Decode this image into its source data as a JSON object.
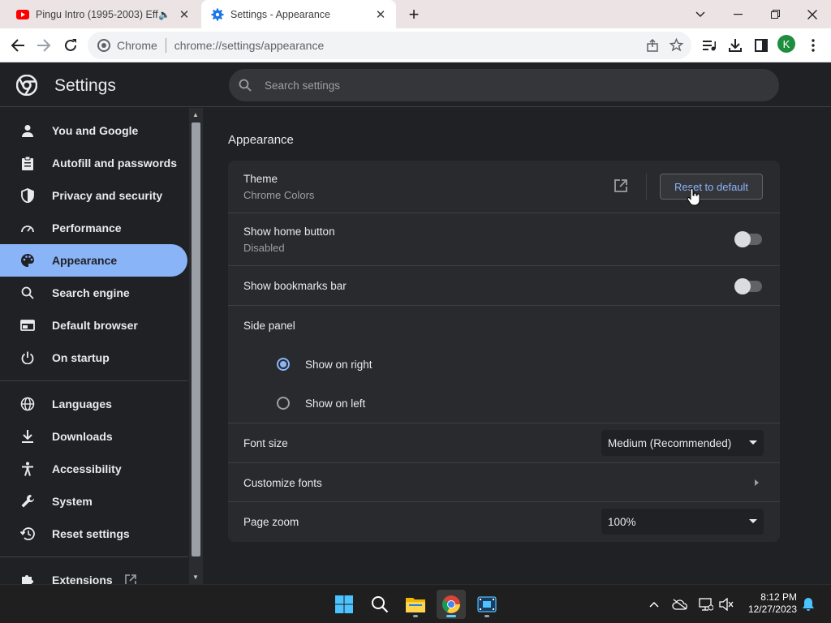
{
  "tabs": [
    {
      "title": "Pingu Intro (1995-2003) Effe",
      "audio": "🔈"
    },
    {
      "title": "Settings - Appearance"
    }
  ],
  "omnibox": {
    "site": "Chrome",
    "url": "chrome://settings/appearance"
  },
  "profile_initial": "K",
  "header": {
    "title": "Settings",
    "search_placeholder": "Search settings"
  },
  "sidebar": {
    "items": [
      {
        "label": "You and Google",
        "icon": "person-icon"
      },
      {
        "label": "Autofill and passwords",
        "icon": "clipboard-icon"
      },
      {
        "label": "Privacy and security",
        "icon": "shield-icon"
      },
      {
        "label": "Performance",
        "icon": "speedometer-icon"
      },
      {
        "label": "Appearance",
        "icon": "palette-icon"
      },
      {
        "label": "Search engine",
        "icon": "search-icon"
      },
      {
        "label": "Default browser",
        "icon": "browser-icon"
      },
      {
        "label": "On startup",
        "icon": "power-icon"
      },
      {
        "label": "Languages",
        "icon": "globe-icon"
      },
      {
        "label": "Downloads",
        "icon": "download-icon"
      },
      {
        "label": "Accessibility",
        "icon": "accessibility-icon"
      },
      {
        "label": "System",
        "icon": "wrench-icon"
      },
      {
        "label": "Reset settings",
        "icon": "history-icon"
      },
      {
        "label": "Extensions",
        "icon": "puzzle-icon"
      }
    ]
  },
  "appearance": {
    "section_title": "Appearance",
    "theme": {
      "label": "Theme",
      "value": "Chrome Colors",
      "reset_label": "Reset to default"
    },
    "home_button": {
      "label": "Show home button",
      "value": "Disabled"
    },
    "bookmarks_bar": {
      "label": "Show bookmarks bar"
    },
    "side_panel": {
      "label": "Side panel",
      "options": [
        "Show on right",
        "Show on left"
      ],
      "selected": "Show on right"
    },
    "font_size": {
      "label": "Font size",
      "value": "Medium (Recommended)"
    },
    "customize_fonts": {
      "label": "Customize fonts"
    },
    "page_zoom": {
      "label": "Page zoom",
      "value": "100%"
    }
  },
  "taskbar": {
    "time": "8:12 PM",
    "date": "12/27/2023"
  },
  "colors": {
    "accent": "#8ab4f8",
    "background": "#202124",
    "card": "#292a2d"
  }
}
